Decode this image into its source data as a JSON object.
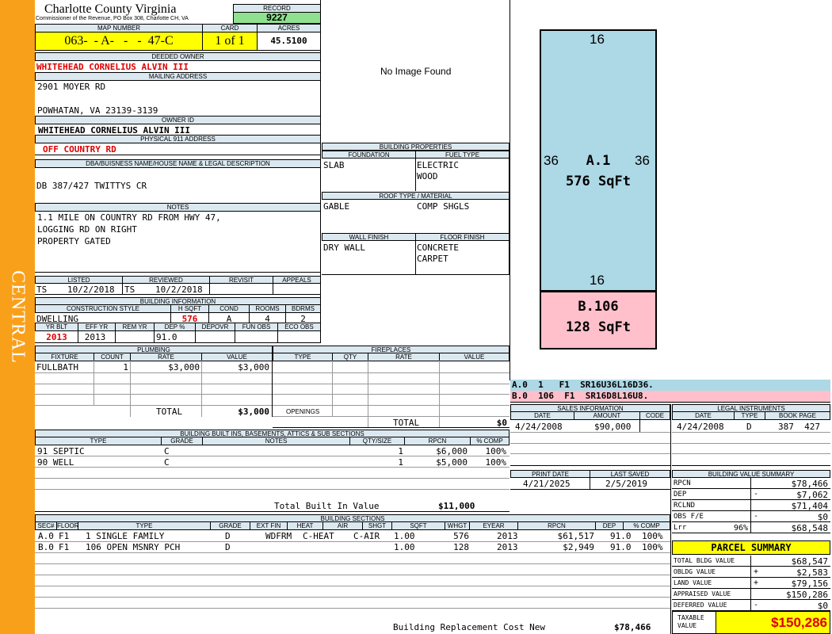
{
  "sidebar": {
    "label": "CENTRAL"
  },
  "county": {
    "title": "Charlotte County Virginia",
    "subtitle": "Commissioner of the Revenue, PO Box 308, Charlotte CH, VA"
  },
  "record": {
    "label": "RECORD",
    "value": "9227"
  },
  "map": {
    "map_label": "MAP NUMBER",
    "map_value": "063-  - A-   -   -  47-C",
    "card_label": "CARD",
    "card_value": "1 of 1",
    "acres_label": "ACRES",
    "acres_value": "45.5100"
  },
  "owner": {
    "deeded_label": "DEEDED OWNER",
    "deeded_value": "WHITEHEAD CORNELIUS ALVIN III",
    "mailing_label": "MAILING ADDRESS",
    "mailing_line1": "2901 MOYER RD",
    "mailing_line2": "POWHATAN, VA 23139-3139",
    "id_label": "OWNER ID",
    "id_value": "WHITEHEAD CORNELIUS ALVIN III",
    "address_label": "PHYSICAL 911 ADDRESS",
    "address_value": "OFF COUNTRY RD"
  },
  "legal": {
    "label": "DBA/BUISNESS NAME/HOUSE NAME & LEGAL DESCRIPTION",
    "value": "DB 387/427 TWITTYS CR"
  },
  "notes": {
    "label": "NOTES",
    "lines": [
      "1.1 MILE ON COUNTRY RD FROM HWY 47,",
      "LOGGING RD ON RIGHT",
      "PROPERTY GATED"
    ]
  },
  "listing": {
    "listed_label": "LISTED",
    "reviewed_label": "REVIEWED",
    "revisit_label": "REVISIT",
    "appeals_label": "APPEALS",
    "listed_by": "TS",
    "listed_date": "10/2/2018",
    "reviewed_by": "TS",
    "reviewed_date": "10/2/2018"
  },
  "building_info": {
    "label": "BUILDING INFORMATION",
    "style_label": "CONSTRUCTION STYLE",
    "hsqft_label": "H SQFT",
    "cond_label": "COND",
    "rooms_label": "ROOMS",
    "bdrms_label": "BDRMS",
    "style": "DWELLING",
    "hsqft": "576",
    "cond": "A",
    "rooms": "4",
    "bdrms": "2",
    "yrblt_label": "YR BLT",
    "effyr_label": "EFF YR",
    "remyr_label": "REM YR",
    "dep_label": "DEP %",
    "depovr_label": "DEPOVR",
    "funobs_label": "FUN OBS",
    "ecoobs_label": "ECO OBS",
    "yrblt": "2013",
    "effyr": "2013",
    "dep": "91.0"
  },
  "image": {
    "placeholder": "No Image Found"
  },
  "building_props": {
    "label": "BUILDING PROPERTIES",
    "foundation_label": "FOUNDATION",
    "fuel_label": "FUEL TYPE",
    "foundation": "SLAB",
    "fuel1": "ELECTRIC",
    "fuel2": "WOOD",
    "roof_label": "ROOF TYPE / MATERIAL",
    "roof1": "GABLE",
    "roof2": "COMP SHGLS",
    "wall_label": "WALL FINISH",
    "floor_label": "FLOOR FINISH",
    "wall": "DRY WALL",
    "floor1": "CONCRETE",
    "floor2": "CARPET"
  },
  "sketch": {
    "a_top": "16",
    "a_left": "36",
    "a_right": "36",
    "a_bottom": "16",
    "a_label": "A.1",
    "a_area": "576 SqFt",
    "b_label": "B.106",
    "b_area": "128 SqFt",
    "a_color": "#add8e6",
    "b_color": "#ffc0cb"
  },
  "sketch_codes": [
    "A.0  1   F1  SR16U36L16D36.",
    "B.0  106  F1  SR16D8L16U8."
  ],
  "plumbing": {
    "label": "PLUMBING",
    "fixture_label": "FIXTURE",
    "count_label": "COUNT",
    "rate_label": "RATE",
    "value_label": "VALUE",
    "rows": [
      {
        "fixture": "FULLBATH",
        "count": "1",
        "rate": "$3,000",
        "value": "$3,000"
      }
    ],
    "total_label": "TOTAL",
    "total": "$3,000"
  },
  "fireplaces": {
    "label": "FIREPLACES",
    "type_label": "TYPE",
    "qty_label": "QTY",
    "rate_label": "RATE",
    "value_label": "VALUE",
    "openings_label": "OPENINGS",
    "total_label": "TOTAL",
    "total": "$0"
  },
  "sales": {
    "label": "SALES INFORMATION",
    "date_label": "DATE",
    "amount_label": "AMOUNT",
    "code_label": "CODE",
    "date": "4/24/2008",
    "amount": "$90,000"
  },
  "legal_instr": {
    "label": "LEGAL INSTRUMENTS",
    "date_label": "DATE",
    "type_label": "TYPE",
    "book_label": "BOOK PAGE",
    "date": "4/24/2008",
    "type": "D",
    "book": "387  427"
  },
  "print": {
    "print_label": "PRINT DATE",
    "saved_label": "LAST SAVED",
    "print_date": "4/21/2025",
    "saved_date": "2/5/2019"
  },
  "built_ins": {
    "label": "BUILDING BUILT INS, BASEMENTS, ATTICS & SUB SECTIONS",
    "type_label": "TYPE",
    "grade_label": "GRADE",
    "notes_label": "NOTES",
    "qty_label": "QTY/SIZE",
    "rpcn_label": "RPCN",
    "pct_label": "% COMP",
    "rows": [
      {
        "type": "91 SEPTIC",
        "grade": "C",
        "qty": "1",
        "rpcn": "$6,000",
        "pct": "100%"
      },
      {
        "type": "90 WELL",
        "grade": "C",
        "qty": "1",
        "rpcn": "$5,000",
        "pct": "100%"
      }
    ],
    "total_label": "Total Built In Value",
    "total": "$11,000"
  },
  "value_summary": {
    "label": "BUILDING VALUE SUMMARY",
    "rows": [
      {
        "label": "RPCN",
        "sign": "",
        "value": "$78,466"
      },
      {
        "label": "DEP",
        "sign": "-",
        "value": "$7,062"
      },
      {
        "label": "RCLND",
        "sign": "",
        "value": "$71,404"
      },
      {
        "label": "OBS F/E",
        "sign": "-",
        "value": "$0"
      },
      {
        "label": "Lrr",
        "pct": "96%",
        "sign": "",
        "value": "$68,548"
      }
    ]
  },
  "sections": {
    "label": "BUILDING SECTIONS",
    "headers": [
      "SEC#",
      "FLOOR",
      "TYPE",
      "GRADE",
      "EXT FIN",
      "HEAT",
      "AIR",
      "SHGT",
      "SQFT",
      "WHGT",
      "EYEAR",
      "RPCN",
      "DEP",
      "% COMP"
    ],
    "rows": [
      {
        "sec": "A.0",
        "floor": "F1",
        "type": "1 SINGLE FAMILY",
        "grade": "D",
        "ext": "WDFRM",
        "heat": "C-HEAT",
        "air": "C-AIR",
        "shgt": "1.00",
        "sqft": "576",
        "eyear": "2013",
        "rpcn": "$61,517",
        "dep": "91.0",
        "pct": "100%"
      },
      {
        "sec": "B.0",
        "floor": "F1",
        "type": "106 OPEN MSNRY PCH",
        "grade": "D",
        "ext": "",
        "heat": "",
        "air": "",
        "shgt": "1.00",
        "sqft": "128",
        "eyear": "2013",
        "rpcn": "$2,949",
        "dep": "91.0",
        "pct": "100%"
      }
    ],
    "replacement_label": "Building Replacement Cost New",
    "replacement": "$78,466"
  },
  "parcel": {
    "label": "PARCEL SUMMARY",
    "rows": [
      {
        "label": "TOTAL BLDG VALUE",
        "sign": "",
        "value": "$68,547"
      },
      {
        "label": "OBLDG VALUE",
        "sign": "+",
        "value": "$2,583"
      },
      {
        "label": "LAND VALUE",
        "sign": "+",
        "value": "$79,156"
      },
      {
        "label": "APPRAISED VALUE",
        "sign": "",
        "value": "$150,286"
      },
      {
        "label": "DEFERRED VALUE",
        "sign": "-",
        "value": "$0"
      }
    ],
    "taxable_label1": "TAXABLE",
    "taxable_label2": "VALUE",
    "taxable": "$150,286",
    "accent": "#ffff00"
  }
}
